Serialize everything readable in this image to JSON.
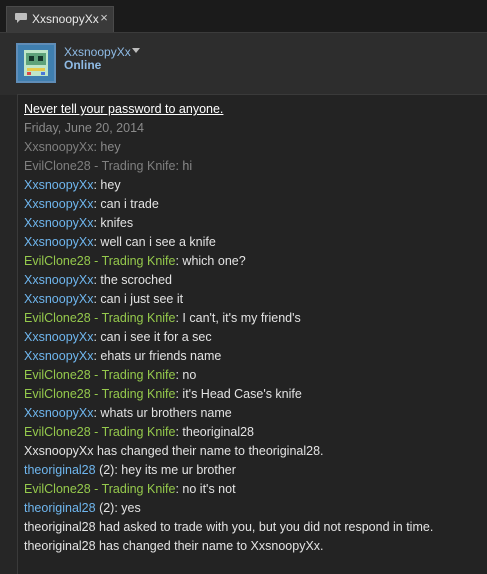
{
  "tab": {
    "title": "XxsnoopyXx",
    "close_glyph": "×",
    "icon": "chat-bubble-icon"
  },
  "header": {
    "username": "XxsnoopyXx",
    "status": "Online",
    "avatar_icon": "robot-avatar"
  },
  "colors": {
    "self_name": "#6fb6ee",
    "friend_name": "#95c94c",
    "old_history": "#8a8a8a",
    "message_text": "#e3e3e3"
  },
  "chat": {
    "warning": "Never tell your password to anyone.",
    "date": "Friday, June 20, 2014",
    "old": [
      {
        "name": "XxsnoopyXx",
        "text": ": hey"
      },
      {
        "name": "EvilClone28 - Trading Knife",
        "text": ": hi"
      }
    ],
    "messages": [
      {
        "name": "XxsnoopyXx",
        "text": ": hey"
      },
      {
        "name": "XxsnoopyXx",
        "text": ": can i trade"
      },
      {
        "name": "XxsnoopyXx",
        "text": ": knifes"
      },
      {
        "name": "XxsnoopyXx",
        "text": ": well can i see a knife"
      },
      {
        "name": "EvilClone28 - Trading Knife",
        "text": ": which one?"
      },
      {
        "name": "XxsnoopyXx",
        "text": ": the scroched"
      },
      {
        "name": "XxsnoopyXx",
        "text": ": can i just see it"
      },
      {
        "name": "EvilClone28 - Trading Knife",
        "text": ": I can't, it's my friend's"
      },
      {
        "name": "XxsnoopyXx",
        "text": ": can i see it for a sec"
      },
      {
        "name": "XxsnoopyXx",
        "text": ": ehats ur friends name"
      },
      {
        "name": "EvilClone28 - Trading Knife",
        "text": ": no"
      },
      {
        "name": "EvilClone28 - Trading Knife",
        "text": ": it's Head Case's knife"
      },
      {
        "name": "XxsnoopyXx",
        "text": ": whats ur brothers name"
      },
      {
        "name": "EvilClone28 - Trading Knife",
        "text": ": theoriginal28"
      }
    ],
    "rename_1": "XxsnoopyXx has changed their name to theoriginal28.",
    "after": [
      {
        "name": "theoriginal28",
        "text": " (2): hey its me ur brother"
      },
      {
        "name": "EvilClone28 - Trading Knife",
        "text": ": no it's not"
      },
      {
        "name": "theoriginal28",
        "text": " (2): yes"
      }
    ],
    "trade_notice": "theoriginal28 had asked to trade with you, but you did not respond in time.",
    "rename_2": "theoriginal28 has changed their name to XxsnoopyXx."
  }
}
